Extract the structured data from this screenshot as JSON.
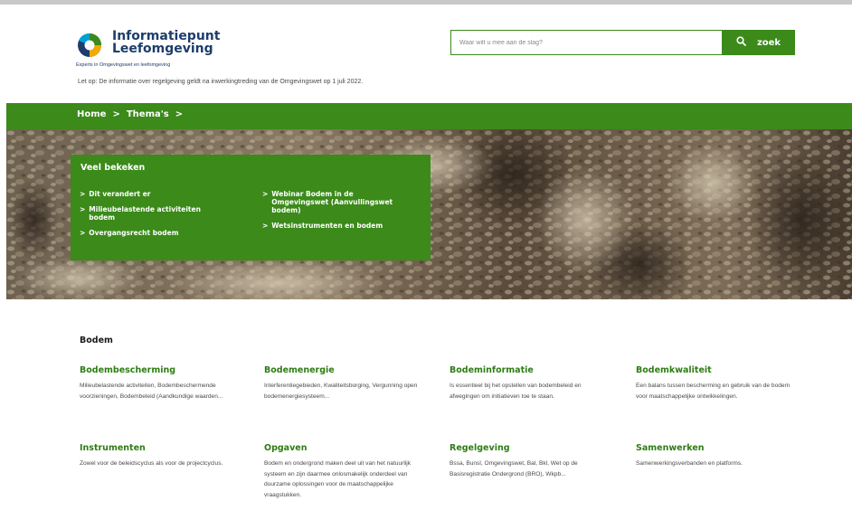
{
  "header": {
    "logo_line1": "Informatiepunt",
    "logo_line2": "Leefomgeving",
    "tagline": "Experts in Omgevingswet en leefomgeving",
    "logo_colors": [
      "#1e3d6b",
      "#3b8a1a",
      "#f2a900",
      "#00a0d6"
    ]
  },
  "notice": "Let op: De informatie over regelgeving geldt na inwerkingtreding van de Omgevingswet op 1 juli 2022.",
  "search": {
    "placeholder": "Waar wilt u mee aan de slag?",
    "value": "",
    "button_label": "zoek",
    "icon": "search-icon"
  },
  "breadcrumb": {
    "items": [
      "Home",
      "Thema's"
    ],
    "separator": ">"
  },
  "veel_bekeken": {
    "title": "Veel bekeken",
    "left": [
      "Dit verandert er",
      "Milieubelastende activiteiten bodem",
      "Overgangsrecht bodem"
    ],
    "right": [
      "Webinar Bodem in de Omgevingswet (Aanvullingswet bodem)",
      "Wetsinstrumenten en bodem"
    ],
    "chevron": ">"
  },
  "section": {
    "title": "Bodem"
  },
  "cards": [
    {
      "title": "Bodembescherming",
      "desc": "Milieubelastende activiteiten, Bodembeschermende voorzieningen, Bodembeleid (Aandkundige waarden..."
    },
    {
      "title": "Bodemenergie",
      "desc": "Interferentiegebieden, Kwaliteitsborging, Vergunning open bodemenergiesysteem..."
    },
    {
      "title": "Bodeminformatie",
      "desc": "Is essentieel bij het opstellen van bodembeleid en afwegingen om initiatieven toe te staan."
    },
    {
      "title": "Bodemkwaliteit",
      "desc": "Een balans tussen bescherming en gebruik van de bodem voor maatschappelijke ontwikkelingen."
    },
    {
      "title": "Instrumenten",
      "desc": "Zowel voor de beleidscyclus als voor de projectcyclus."
    },
    {
      "title": "Opgaven",
      "desc": "Bodem en ondergrond maken deel uit van het natuurlijk systeem en zijn daarmee onlosmakelijk onderdeel van duurzame oplossingen voor de maatschappelijke vraagstukken."
    },
    {
      "title": "Regelgeving",
      "desc": "Bssa, Bunsl, Omgevingswet, Bal, Bkl, Wet op de Basisregistratie Ondergrond (BRO), Wkpb..."
    },
    {
      "title": "Samenwerken",
      "desc": "Samenwerkingsverbanden en platforms."
    }
  ],
  "colors": {
    "brand_green": "#3b8a1a",
    "link_green": "#2e7d14",
    "brand_blue": "#1e3d6b"
  }
}
